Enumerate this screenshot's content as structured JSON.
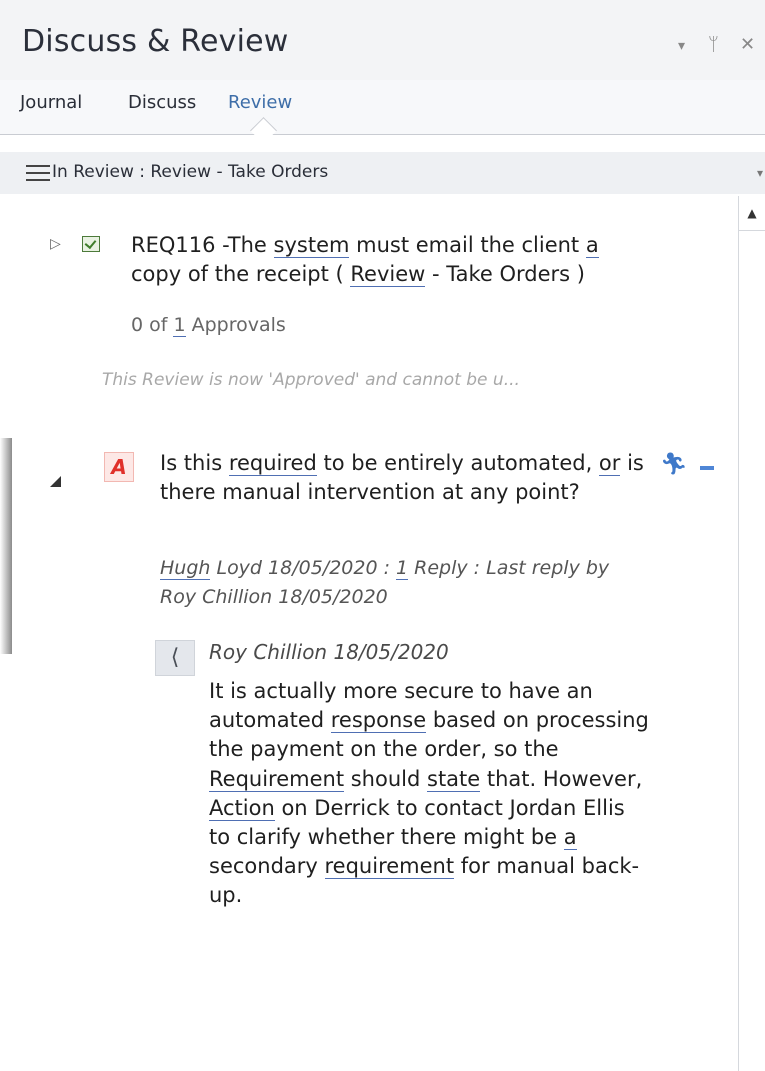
{
  "window": {
    "title": "Discuss & Review",
    "controls": {
      "dropdown": "▾",
      "pin": "ᛘ",
      "close": "✕"
    }
  },
  "tabs": [
    {
      "label": "Journal",
      "active": false
    },
    {
      "label": "Discuss",
      "active": false
    },
    {
      "label": "Review",
      "active": true
    }
  ],
  "review_header": {
    "label": "In Review : Review - Take Orders"
  },
  "requirement": {
    "text_parts": [
      "REQ116 -The ",
      "system",
      " must email the client ",
      "a",
      " copy of the receipt ( ",
      "Review",
      " - Take Orders )"
    ],
    "approvals_prefix": "0 of ",
    "approvals_count": "1",
    "approvals_suffix": " Approvals",
    "note": "This Review is now 'Approved' and cannot be u..."
  },
  "discussion": {
    "avatar_letter": "A",
    "text_parts": [
      "Is this ",
      "required",
      " to be entirely automated, ",
      "or",
      " is there manual intervention at any point?"
    ],
    "meta_parts": [
      "Hugh",
      " Loyd 18/05/2020 : ",
      "1",
      " Reply :  Last reply by Roy Chillion 18/05/2020"
    ],
    "icons": [
      "action-runner-icon",
      "collapse-minus-icon"
    ]
  },
  "reply": {
    "author_date": "Roy Chillion  18/05/2020",
    "text_parts": [
      "It is actually more secure to have an automated ",
      "response",
      " based on processing the payment on the order, so the ",
      "Requirement",
      " should ",
      "state",
      " that. However, ",
      "Action",
      " on Derrick to contact Jordan Ellis to clarify whether there might be ",
      "a",
      " secondary ",
      "requirement",
      " for manual back-up."
    ]
  },
  "colors": {
    "link_underline": "#4f6fb3",
    "active_tab": "#3e6ea8",
    "avatar_red": "#e0302a",
    "action_blue": "#3f79c9"
  }
}
